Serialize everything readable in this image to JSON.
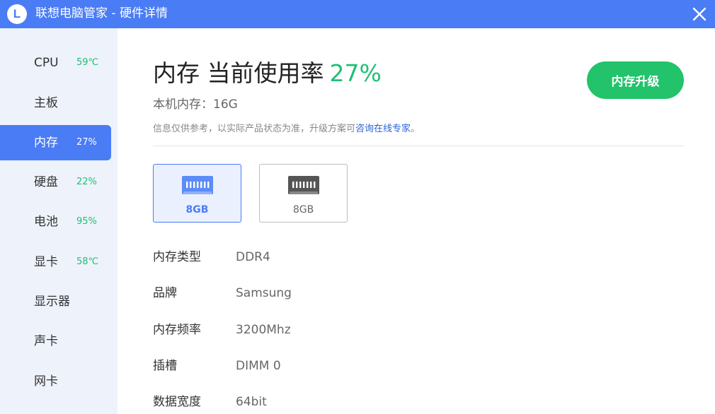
{
  "window": {
    "logo_letter": "L",
    "title": "联想电脑管家 - 硬件详情"
  },
  "sidebar": {
    "items": [
      {
        "label": "CPU",
        "value": "59℃"
      },
      {
        "label": "主板",
        "value": ""
      },
      {
        "label": "内存",
        "value": "27%"
      },
      {
        "label": "硬盘",
        "value": "22%"
      },
      {
        "label": "电池",
        "value": "95%"
      },
      {
        "label": "显卡",
        "value": "58℃"
      },
      {
        "label": "显示器",
        "value": ""
      },
      {
        "label": "声卡",
        "value": ""
      },
      {
        "label": "网卡",
        "value": ""
      }
    ],
    "active_index": 2
  },
  "main": {
    "heading": "内存 当前使用率",
    "usage": "27%",
    "total_label": "本机内存：16G",
    "notice_text": "信息仅供参考，以实际产品状态为准，升级方案可",
    "notice_link": "咨询在线专家",
    "notice_end": "。",
    "upgrade_button": "内存升级",
    "slots": [
      {
        "capacity": "8GB",
        "selected": true
      },
      {
        "capacity": "8GB",
        "selected": false
      }
    ],
    "specs": [
      {
        "key": "内存类型",
        "value": "DDR4"
      },
      {
        "key": "品牌",
        "value": "Samsung"
      },
      {
        "key": "内存频率",
        "value": "3200Mhz"
      },
      {
        "key": "插槽",
        "value": "DIMM 0"
      },
      {
        "key": "数据宽度",
        "value": "64bit"
      }
    ]
  },
  "colors": {
    "accent": "#4a7cf5",
    "green": "#1fbf76",
    "button_green": "#22c36b"
  },
  "icons": {
    "close": "close-icon",
    "memory": "ram-stick-icon"
  }
}
